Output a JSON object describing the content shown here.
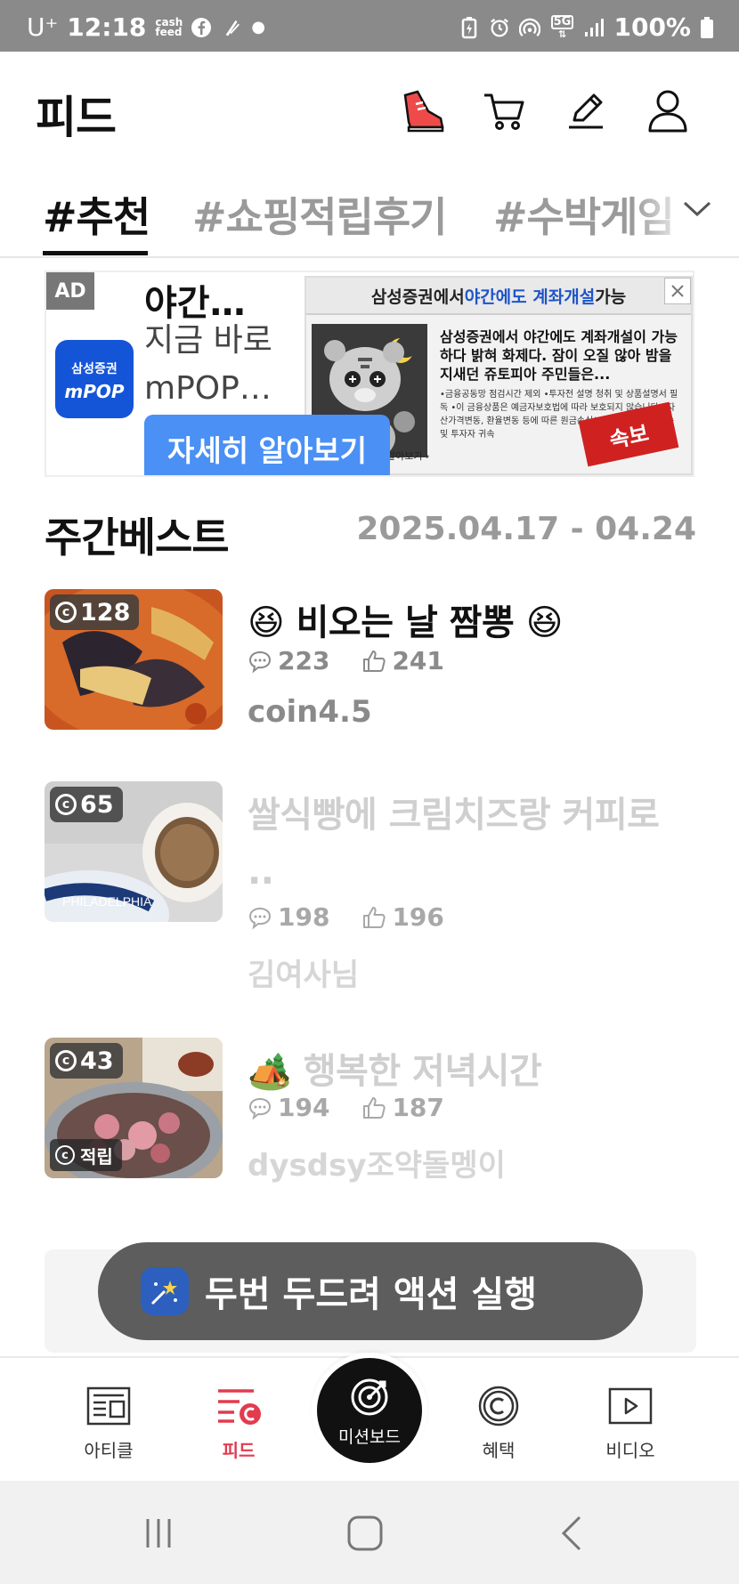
{
  "status_bar": {
    "carrier": "U⁺",
    "time": "12:18",
    "cashfeed_label": "cash feed",
    "network": "5G",
    "battery": "100%"
  },
  "header": {
    "title": "피드"
  },
  "tabs": [
    {
      "label": "#추천",
      "active": true
    },
    {
      "label": "#쇼핑적립후기",
      "active": false
    },
    {
      "label": "#수박게임",
      "active": false
    }
  ],
  "ad": {
    "badge": "AD",
    "brand_line1": "삼성증권",
    "brand_line2": "mPOP",
    "title": "야간…",
    "description": "지금 바로 mPOP…",
    "cta": "자세히 알아보기",
    "banner_header_prefix": "삼성증권에서 ",
    "banner_header_highlight": "야간에도 계좌개설",
    "banner_header_suffix": " 가능",
    "banner_headline": "삼성증권에서 야간에도 계좌개설이 가능하다 밝혀 화제다. 잠이 오질 않아 밤을 지새던 쥬토피아 주민들은...",
    "banner_fine": "•금융공동망 점검시간 제외 •투자전 설명 청취 및 상품설명서 필독 •이 금융상품은 예금자보호법에 따라 보호되지 않습니다 •자산가격변동, 환율변동 등에 따른 원금손실(0~100%) 발생가능 및 투자자 귀속",
    "banner_stamp": "속보",
    "banner_more": "알아보기 ›"
  },
  "weekly_best": {
    "title": "주간베스트",
    "date_range": "2025.04.17 - 04.24",
    "posts": [
      {
        "coins": "128",
        "title": "😆 비오는 날 짬뽕 😆",
        "comments": "223",
        "likes": "241",
        "author": "coin4.5",
        "faded": false
      },
      {
        "coins": "65",
        "title": "쌀식빵에 크림치즈랑 커피로 ..",
        "comments": "198",
        "likes": "196",
        "author": "김여사님",
        "faded": true
      },
      {
        "coins": "43",
        "title": "🏕️ 행복한 저녁시간",
        "comments": "194",
        "likes": "187",
        "author": "dysdsy조약돌멩이",
        "faded": true,
        "earn_label": "적립"
      }
    ]
  },
  "toast": {
    "text": "두번 두드려 액션 실행"
  },
  "bottom_nav": {
    "items": [
      {
        "label": "아티클",
        "icon": "article-icon"
      },
      {
        "label": "피드",
        "icon": "feed-icon",
        "active": true
      },
      {
        "label": "미션보드",
        "icon": "target-icon"
      },
      {
        "label": "혜택",
        "icon": "coin-icon"
      },
      {
        "label": "비디오",
        "icon": "video-icon"
      }
    ]
  },
  "colors": {
    "accent": "#e23b4e",
    "ad_cta": "#4a90f5",
    "ad_logo": "#1455d8",
    "status_bar": "#8a8a8a"
  }
}
